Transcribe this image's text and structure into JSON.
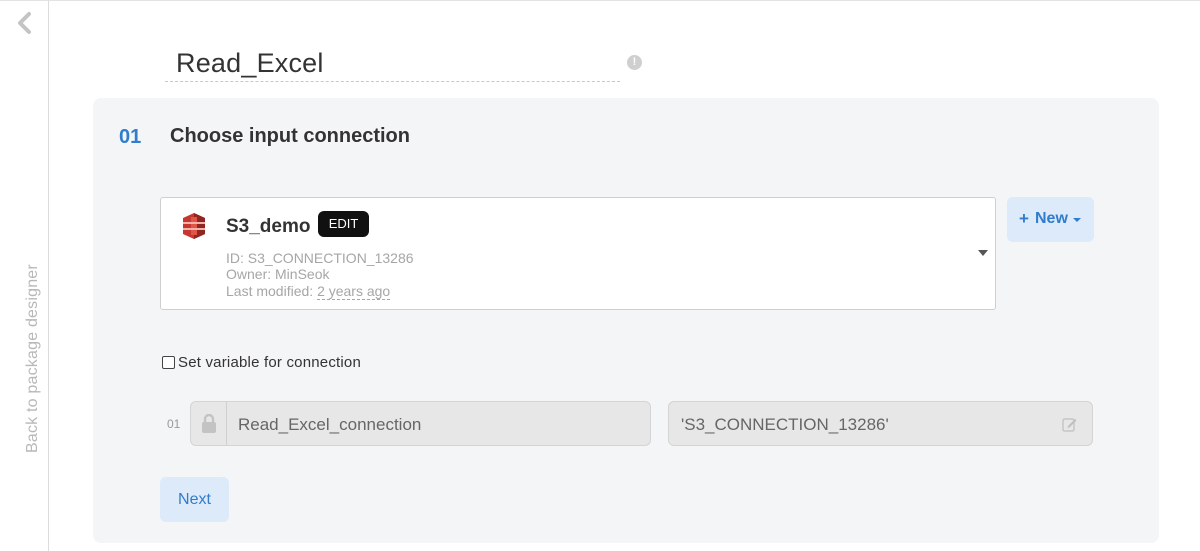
{
  "sidebar": {
    "back_label": "Back to package designer"
  },
  "header": {
    "title": "Read_Excel"
  },
  "step": {
    "number": "01",
    "title": "Choose input connection"
  },
  "connection": {
    "name": "S3_demo",
    "edit_label": "EDIT",
    "id_line": "ID: S3_CONNECTION_13286",
    "owner_line": "Owner: MinSeok",
    "modified_prefix": "Last modified: ",
    "modified_ago": "2 years ago"
  },
  "new_button": {
    "plus": "+",
    "label": "New"
  },
  "variable": {
    "checkbox_label": "Set variable for connection",
    "row_number": "01",
    "name": "Read_Excel_connection",
    "value": "'S3_CONNECTION_13286'"
  },
  "next_button": {
    "label": "Next"
  },
  "colors": {
    "accent": "#2f7dcc",
    "accent_bg": "#ddeafa",
    "s3_red": "#c7372f",
    "panel_bg": "#f4f5f7"
  }
}
